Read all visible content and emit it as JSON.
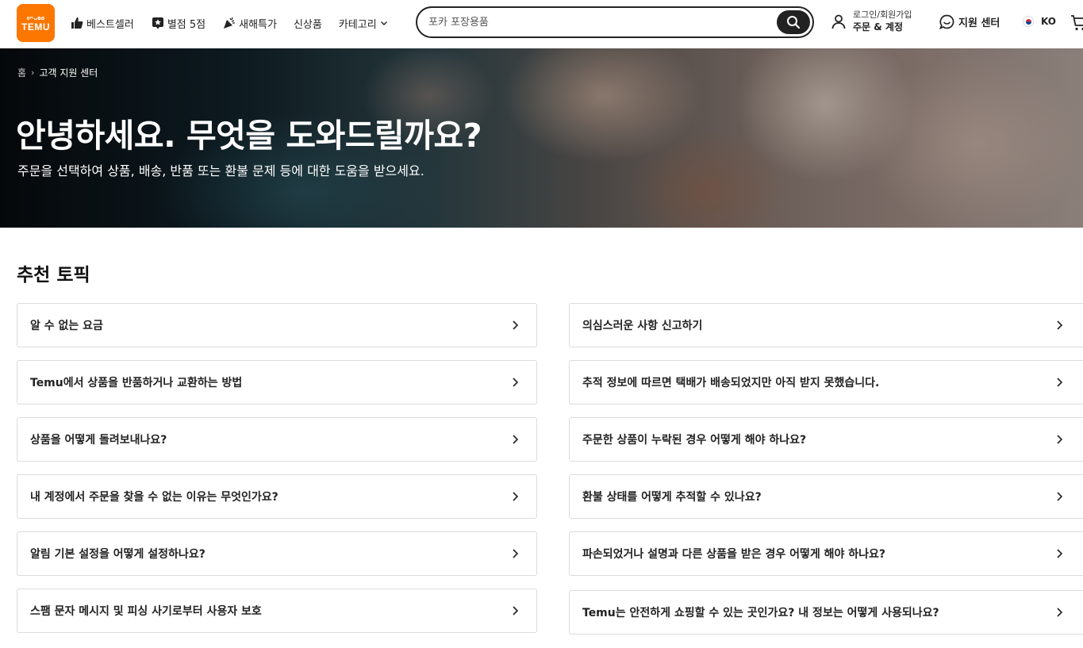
{
  "header": {
    "logo": {
      "glyphs": "ᴕᴖᴗᴓᴑ",
      "word": "TEMU"
    },
    "nav": [
      {
        "label": "베스트셀러",
        "icon": "thumbs-up-icon"
      },
      {
        "label": "별점 5점",
        "icon": "star-badge-icon"
      },
      {
        "label": "새해특가",
        "icon": "party-popper-icon"
      },
      {
        "label": "신상품",
        "icon": ""
      },
      {
        "label": "카테고리",
        "icon": "chevron-down-icon"
      }
    ],
    "search": {
      "placeholder": "포카 포장용품",
      "icon": "search-icon"
    },
    "account": {
      "line1": "로그인/회원가입",
      "line2": "주문 & 계정",
      "icon": "user-icon"
    },
    "support": {
      "label": "지원 센터",
      "icon": "chat-smile-icon"
    },
    "language": {
      "code": "KO",
      "icon": "korea-flag-icon"
    },
    "cart_icon": "cart-icon"
  },
  "hero": {
    "breadcrumb": {
      "home": "홈",
      "current": "고객 지원 센터"
    },
    "title": "안녕하세요. 무엇을 도와드릴까요?",
    "subtitle": "주문을 선택하여 상품, 배송, 반품 또는 환불 문제 등에 대한 도움을 받으세요."
  },
  "topics": {
    "title": "추천 토픽",
    "left": [
      "알 수 없는 요금",
      "Temu에서 상품을 반품하거나 교환하는 방법",
      "상품을 어떻게 돌려보내나요?",
      "내 계정에서 주문을 찾을 수 없는 이유는 무엇인가요?",
      "알림 기본 설정을 어떻게 설정하나요?",
      "스팸 문자 메시지 및 피싱 사기로부터 사용자 보호"
    ],
    "right": [
      "의심스러운 사항 신고하기",
      "추적 정보에 따르면 택배가 배송되었지만 아직 받지 못했습니다.",
      "주문한 상품이 누락된 경우 어떻게 해야 하나요?",
      "환불 상태를 어떻게 추적할 수 있나요?",
      "파손되었거나 설명과 다른 상품을 받은 경우 어떻게 해야 하나요?",
      "Temu는 안전하게 쇼핑할 수 있는 곳인가요? 내 정보는 어떻게 사용되나요?"
    ]
  },
  "colors": {
    "brand": "#fb7701",
    "text": "#222222",
    "border": "#dcdcdc"
  }
}
